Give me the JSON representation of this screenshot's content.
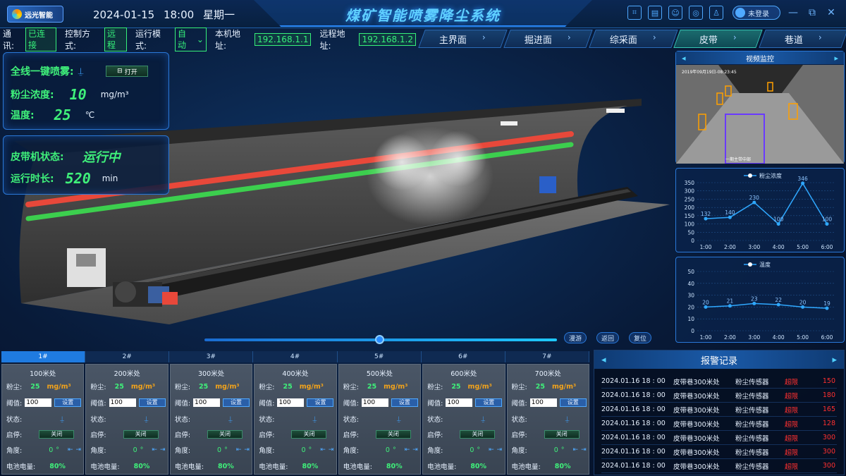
{
  "header": {
    "logo_text": "远光智能",
    "date": "2024-01-15",
    "time": "18:00",
    "weekday": "星期一",
    "title": "煤矿智能喷雾降尘系统",
    "login_label": "未登录",
    "icons": [
      "qr-scan-icon",
      "document-icon",
      "face-scan-icon",
      "target-icon",
      "user-scan-icon"
    ]
  },
  "status": {
    "comm_label": "通讯:",
    "comm_value": "已连接",
    "control_label": "控制方式:",
    "control_value": "远程",
    "mode_label": "运行模式:",
    "mode_value": "自动",
    "local_label": "本机地址:",
    "local_value": "192.168.1.1",
    "remote_label": "远程地址:",
    "remote_value": "192.168.1.2"
  },
  "nav": {
    "tabs": [
      {
        "label": "主界面",
        "active": false
      },
      {
        "label": "掘进面",
        "active": false
      },
      {
        "label": "综采面",
        "active": false
      },
      {
        "label": "皮带",
        "active": true
      },
      {
        "label": "巷道",
        "active": false
      }
    ]
  },
  "spray_panel": {
    "one_key_label": "全线一键喷雾:",
    "open_label": "打开",
    "dust_label": "粉尘浓度:",
    "dust_value": "10",
    "dust_unit": "mg/m³",
    "temp_label": "温度:",
    "temp_value": "25",
    "temp_unit": "℃"
  },
  "belt_panel": {
    "state_label": "皮带机状态:",
    "state_value": "运行中",
    "runtime_label": "运行时长:",
    "runtime_value": "520",
    "runtime_unit": "min"
  },
  "playback": {
    "btn_tour": "漫游",
    "btn_back": "返回",
    "btn_reset": "复位"
  },
  "sensors": {
    "tabs": [
      "1#",
      "2#",
      "3#",
      "4#",
      "5#",
      "6#",
      "7#"
    ],
    "active_tab": 0,
    "labels": {
      "dust": "粉尘:",
      "threshold": "阈值:",
      "set": "设置",
      "state": "状态:",
      "startstop": "启停:",
      "off": "关闭",
      "angle": "角度:",
      "battery": "电池电量:"
    },
    "cards": [
      {
        "name": "100米处",
        "dust": "25",
        "unit": "mg/m³",
        "threshold": "100",
        "angle": "0",
        "deg": "°",
        "battery": "80%"
      },
      {
        "name": "200米处",
        "dust": "25",
        "unit": "mg/m³",
        "threshold": "100",
        "angle": "0",
        "deg": "°",
        "battery": "80%"
      },
      {
        "name": "300米处",
        "dust": "25",
        "unit": "mg/m³",
        "threshold": "100",
        "angle": "0",
        "deg": "°",
        "battery": "80%"
      },
      {
        "name": "400米处",
        "dust": "25",
        "unit": "mg/m³",
        "threshold": "100",
        "angle": "0",
        "deg": "°",
        "battery": "80%"
      },
      {
        "name": "500米处",
        "dust": "25",
        "unit": "mg/m³",
        "threshold": "100",
        "angle": "0",
        "deg": "°",
        "battery": "80%"
      },
      {
        "name": "600米处",
        "dust": "25",
        "unit": "mg/m³",
        "threshold": "100",
        "angle": "0",
        "deg": "°",
        "battery": "80%"
      },
      {
        "name": "700米处",
        "dust": "25",
        "unit": "mg/m³",
        "threshold": "100",
        "angle": "0",
        "deg": "°",
        "battery": "80%"
      }
    ]
  },
  "video": {
    "title": "视频监控",
    "overlay_time": "2019年09月19日-08:23:45",
    "overlay_bottom": "一期主带中部"
  },
  "chart_data": [
    {
      "type": "line",
      "legend": "粉尘浓度",
      "categories": [
        "1:00",
        "2:00",
        "3:00",
        "4:00",
        "5:00",
        "6:00"
      ],
      "series": [
        {
          "name": "粉尘浓度",
          "values": [
            132,
            140,
            230,
            100,
            346,
            100
          ]
        }
      ],
      "point_labels": [
        "132",
        "140",
        "230",
        "100",
        "346",
        "100"
      ],
      "yticks": [
        0,
        50,
        100,
        150,
        200,
        250,
        300,
        350
      ],
      "ylim": [
        0,
        350
      ],
      "color": "#2fa8ff"
    },
    {
      "type": "line",
      "legend": "温度",
      "categories": [
        "1:00",
        "2:00",
        "3:00",
        "4:00",
        "5:00",
        "6:00"
      ],
      "series": [
        {
          "name": "温度",
          "values": [
            20,
            21,
            23,
            22,
            20,
            19
          ]
        }
      ],
      "point_labels": [
        "20",
        "21",
        "23",
        "22",
        "20",
        "19"
      ],
      "yticks": [
        0,
        10,
        20,
        30,
        40,
        50
      ],
      "ylim": [
        0,
        50
      ],
      "color": "#2fa8ff"
    }
  ],
  "alarm": {
    "title": "报警记录",
    "rows": [
      {
        "time": "2024.01.16 18 : 00",
        "place": "皮带巷300米处",
        "device": "粉尘传感器",
        "level": "超限",
        "value": "150"
      },
      {
        "time": "2024.01.16 18 : 00",
        "place": "皮带巷300米处",
        "device": "粉尘传感器",
        "level": "超限",
        "value": "180"
      },
      {
        "time": "2024.01.16 18 : 00",
        "place": "皮带巷300米处",
        "device": "粉尘传感器",
        "level": "超限",
        "value": "165"
      },
      {
        "time": "2024.01.16 18 : 00",
        "place": "皮带巷300米处",
        "device": "粉尘传感器",
        "level": "超限",
        "value": "128"
      },
      {
        "time": "2024.01.16 18 : 00",
        "place": "皮带巷300米处",
        "device": "粉尘传感器",
        "level": "超限",
        "value": "300"
      },
      {
        "time": "2024.01.16 18 : 00",
        "place": "皮带巷300米处",
        "device": "粉尘传感器",
        "level": "超限",
        "value": "300"
      },
      {
        "time": "2024.01.16 18 : 00",
        "place": "皮带巷300米处",
        "device": "粉尘传感器",
        "level": "超限",
        "value": "300"
      }
    ]
  },
  "colors": {
    "accent": "#2a8cff",
    "ok_green": "#3ff07a",
    "alarm_red": "#ff3030",
    "pipe_red": "#e8483a",
    "pipe_green": "#3ccf4e"
  }
}
